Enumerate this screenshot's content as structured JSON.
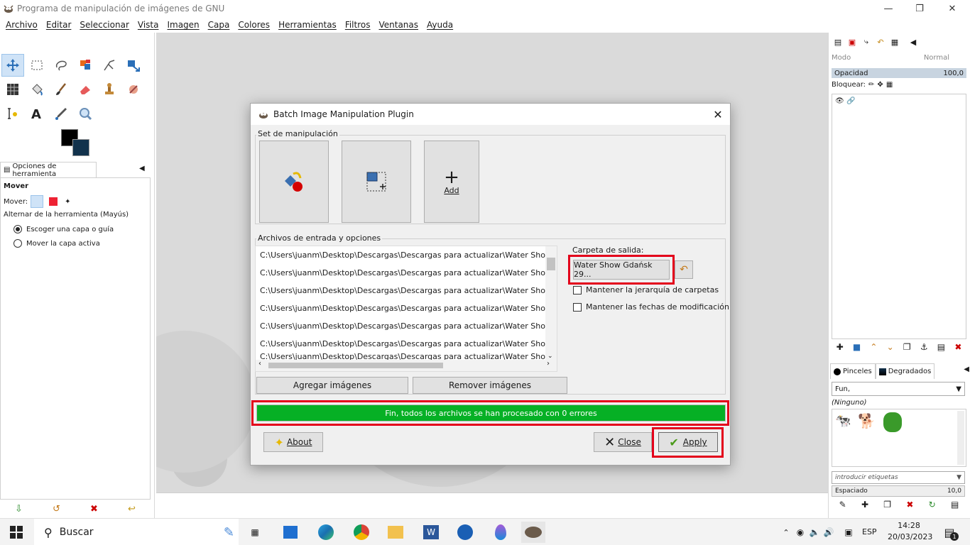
{
  "window": {
    "title": "Programa de manipulación de imágenes de GNU",
    "app_icon": "gimp-icon",
    "controls": [
      "minimize-icon",
      "restore-icon",
      "close-icon"
    ]
  },
  "menubar": [
    "Archivo",
    "Editar",
    "Seleccionar",
    "Vista",
    "Imagen",
    "Capa",
    "Colores",
    "Herramientas",
    "Filtros",
    "Ventanas",
    "Ayuda"
  ],
  "toolbox": {
    "tools": [
      "move-tool-icon",
      "rect-select-icon",
      "free-select-icon",
      "fuzzy-select-icon",
      "paths-icon",
      "transform-icon",
      "warp-icon",
      "bucket-fill-icon",
      "paintbrush-icon",
      "eraser-icon",
      "clone-icon",
      "smudge-icon",
      "text-cursor-icon",
      "text-tool-icon",
      "color-picker-icon",
      "zoom-icon"
    ],
    "fg_color": "#000000",
    "bg_color": "#12324c",
    "options_tab": "Opciones de herramienta",
    "options_title": "Mover",
    "mode_label": "Mover:",
    "alt_label": "Alternar de la herramienta  (Mayús)",
    "radio1": "Escoger una capa o guía",
    "radio2": "Mover la capa activa"
  },
  "dialog": {
    "title": "Batch Image Manipulation Plugin",
    "manip_group": "Set de manipulación",
    "add_label": "Add",
    "files_group": "Archivos de entrada y opciones",
    "files": [
      "C:\\Users\\juanm\\Desktop\\Descargas\\Descargas para actualizar\\Water Show Gdańsk",
      "C:\\Users\\juanm\\Desktop\\Descargas\\Descargas para actualizar\\Water Show Gdańsk",
      "C:\\Users\\juanm\\Desktop\\Descargas\\Descargas para actualizar\\Water Show Gdańsk",
      "C:\\Users\\juanm\\Desktop\\Descargas\\Descargas para actualizar\\Water Show Gdańsk",
      "C:\\Users\\juanm\\Desktop\\Descargas\\Descargas para actualizar\\Water Show Gdańsk",
      "C:\\Users\\juanm\\Desktop\\Descargas\\Descargas para actualizar\\Water Show Gdańsk",
      "C:\\Users\\juanm\\Desktop\\Descargas\\Descargas para actualizar\\Water Show Gdańsk"
    ],
    "output_label": "Carpeta de salida:",
    "output_folder": "Water Show Gdańsk 29...",
    "keep_hierarchy": "Mantener la jerarquía de carpetas",
    "keep_dates": "Mantener las fechas de modificación",
    "add_images": "Agregar imágenes",
    "remove_images": "Remover imágenes",
    "progress_text": "Fin, todos los archivos se han procesado con 0 errores",
    "progress_value": 1.0,
    "about": "About",
    "close": "Close",
    "apply": "Apply"
  },
  "rightdock": {
    "mode_label": "Modo",
    "mode_value": "Normal",
    "opacity_label": "Opacidad",
    "opacity_value": "100,0",
    "lock_label": "Bloquear:",
    "brushes_tab": "Pinceles",
    "gradients_tab": "Degradados",
    "brush_filter": "Fun,",
    "brush_none": "(Ninguno)",
    "tags_placeholder": "introducir etiquetas",
    "spacing_label": "Espaciado",
    "spacing_value": "10,0"
  },
  "taskbar": {
    "search": "Buscar",
    "language": "ESP",
    "time": "14:28",
    "date": "20/03/2023",
    "notifications": "1"
  },
  "colors": {
    "highlight_red": "#e3001b",
    "progress_green": "#06b025"
  }
}
